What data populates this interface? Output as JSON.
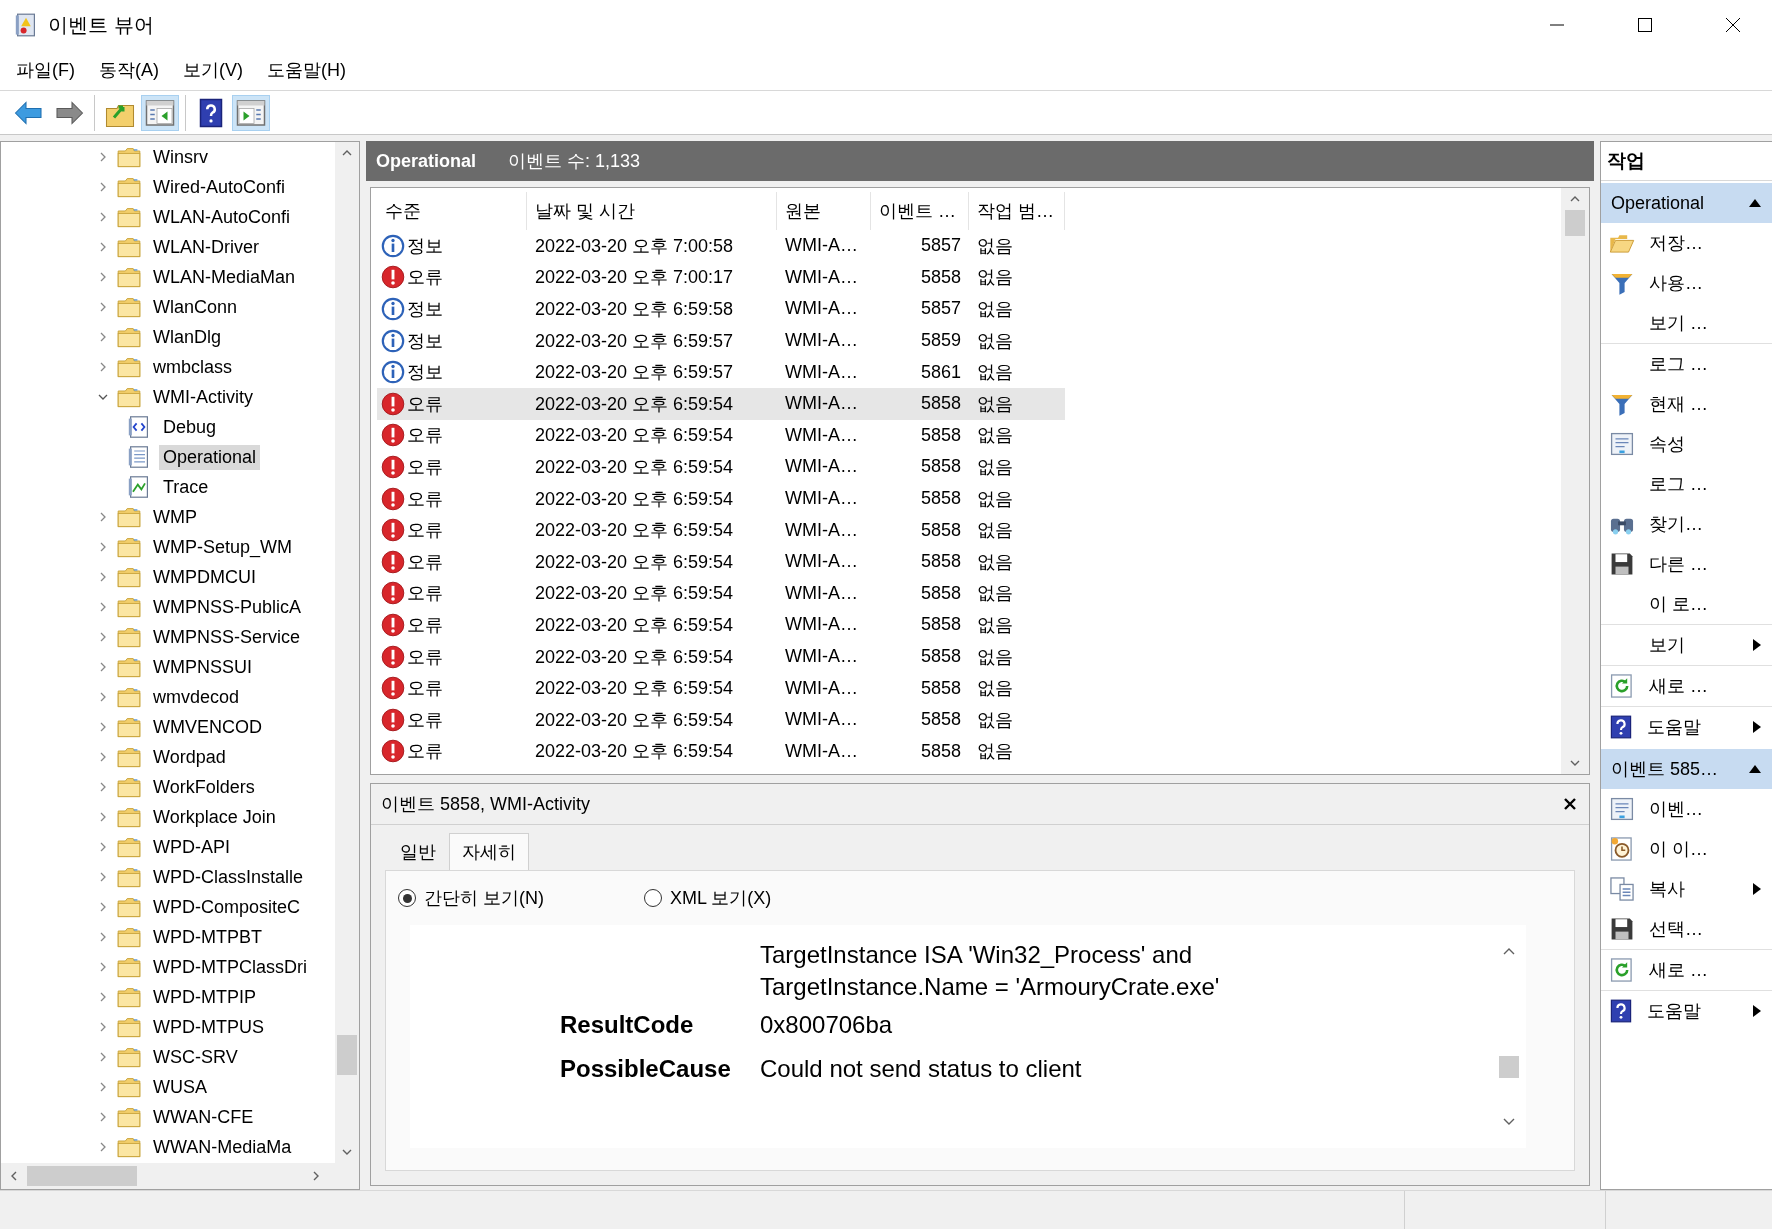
{
  "window": {
    "title": "이벤트 뷰어"
  },
  "menu": [
    "파일(F)",
    "동작(A)",
    "보기(V)",
    "도움말(H)"
  ],
  "toolbar": [
    [
      {
        "kind": "back",
        "pressed": false
      },
      {
        "kind": "forward",
        "pressed": false
      }
    ],
    [
      {
        "kind": "up",
        "pressed": false
      },
      {
        "kind": "tree",
        "pressed": true
      }
    ],
    [
      {
        "kind": "help",
        "pressed": false
      },
      {
        "kind": "actions",
        "pressed": true
      }
    ]
  ],
  "tree": [
    {
      "label": "Winsrv",
      "kind": "folder",
      "expanded": false,
      "selected": false
    },
    {
      "label": "Wired-AutoConfi",
      "kind": "folder",
      "expanded": false,
      "selected": false
    },
    {
      "label": "WLAN-AutoConfi",
      "kind": "folder",
      "expanded": false,
      "selected": false
    },
    {
      "label": "WLAN-Driver",
      "kind": "folder",
      "expanded": false,
      "selected": false
    },
    {
      "label": "WLAN-MediaMan",
      "kind": "folder",
      "expanded": false,
      "selected": false
    },
    {
      "label": "WlanConn",
      "kind": "folder",
      "expanded": false,
      "selected": false
    },
    {
      "label": "WlanDlg",
      "kind": "folder",
      "expanded": false,
      "selected": false
    },
    {
      "label": "wmbclass",
      "kind": "folder",
      "expanded": false,
      "selected": false
    },
    {
      "label": "WMI-Activity",
      "kind": "folder",
      "expanded": true,
      "selected": false,
      "children": [
        {
          "label": "Debug",
          "kind": "debug",
          "selected": false
        },
        {
          "label": "Operational",
          "kind": "log",
          "selected": true
        },
        {
          "label": "Trace",
          "kind": "trace",
          "selected": false
        }
      ]
    },
    {
      "label": "WMP",
      "kind": "folder",
      "expanded": false,
      "selected": false
    },
    {
      "label": "WMP-Setup_WM",
      "kind": "folder",
      "expanded": false,
      "selected": false
    },
    {
      "label": "WMPDMCUI",
      "kind": "folder",
      "expanded": false,
      "selected": false
    },
    {
      "label": "WMPNSS-PublicA",
      "kind": "folder",
      "expanded": false,
      "selected": false
    },
    {
      "label": "WMPNSS-Service",
      "kind": "folder",
      "expanded": false,
      "selected": false
    },
    {
      "label": "WMPNSSUI",
      "kind": "folder",
      "expanded": false,
      "selected": false
    },
    {
      "label": "wmvdecod",
      "kind": "folder",
      "expanded": false,
      "selected": false
    },
    {
      "label": "WMVENCOD",
      "kind": "folder",
      "expanded": false,
      "selected": false
    },
    {
      "label": "Wordpad",
      "kind": "folder",
      "expanded": false,
      "selected": false
    },
    {
      "label": "WorkFolders",
      "kind": "folder",
      "expanded": false,
      "selected": false
    },
    {
      "label": "Workplace Join",
      "kind": "folder",
      "expanded": false,
      "selected": false
    },
    {
      "label": "WPD-API",
      "kind": "folder",
      "expanded": false,
      "selected": false
    },
    {
      "label": "WPD-ClassInstalle",
      "kind": "folder",
      "expanded": false,
      "selected": false
    },
    {
      "label": "WPD-CompositeC",
      "kind": "folder",
      "expanded": false,
      "selected": false
    },
    {
      "label": "WPD-MTPBT",
      "kind": "folder",
      "expanded": false,
      "selected": false
    },
    {
      "label": "WPD-MTPClassDri",
      "kind": "folder",
      "expanded": false,
      "selected": false
    },
    {
      "label": "WPD-MTPIP",
      "kind": "folder",
      "expanded": false,
      "selected": false
    },
    {
      "label": "WPD-MTPUS",
      "kind": "folder",
      "expanded": false,
      "selected": false
    },
    {
      "label": "WSC-SRV",
      "kind": "folder",
      "expanded": false,
      "selected": false
    },
    {
      "label": "WUSA",
      "kind": "folder",
      "expanded": false,
      "selected": false
    },
    {
      "label": "WWAN-CFE",
      "kind": "folder",
      "expanded": false,
      "selected": false
    },
    {
      "label": "WWAN-MediaMa",
      "kind": "folder",
      "expanded": false,
      "selected": false
    }
  ],
  "log_header": {
    "name": "Operational",
    "count": "이벤트 수: 1,133"
  },
  "events": {
    "columns": [
      "수준",
      "날짜 및 시간",
      "원본",
      "이벤트 …",
      "작업 범…"
    ],
    "rows": [
      {
        "kind": "info",
        "level": "정보",
        "date": "2022-03-20 오후 7:00:58",
        "source": "WMI-A…",
        "event_id": "5857",
        "task": "없음",
        "selected": false
      },
      {
        "kind": "error",
        "level": "오류",
        "date": "2022-03-20 오후 7:00:17",
        "source": "WMI-A…",
        "event_id": "5858",
        "task": "없음",
        "selected": false
      },
      {
        "kind": "info",
        "level": "정보",
        "date": "2022-03-20 오후 6:59:58",
        "source": "WMI-A…",
        "event_id": "5857",
        "task": "없음",
        "selected": false
      },
      {
        "kind": "info",
        "level": "정보",
        "date": "2022-03-20 오후 6:59:57",
        "source": "WMI-A…",
        "event_id": "5859",
        "task": "없음",
        "selected": false
      },
      {
        "kind": "info",
        "level": "정보",
        "date": "2022-03-20 오후 6:59:57",
        "source": "WMI-A…",
        "event_id": "5861",
        "task": "없음",
        "selected": false
      },
      {
        "kind": "error",
        "level": "오류",
        "date": "2022-03-20 오후 6:59:54",
        "source": "WMI-A…",
        "event_id": "5858",
        "task": "없음",
        "selected": true
      },
      {
        "kind": "error",
        "level": "오류",
        "date": "2022-03-20 오후 6:59:54",
        "source": "WMI-A…",
        "event_id": "5858",
        "task": "없음",
        "selected": false
      },
      {
        "kind": "error",
        "level": "오류",
        "date": "2022-03-20 오후 6:59:54",
        "source": "WMI-A…",
        "event_id": "5858",
        "task": "없음",
        "selected": false
      },
      {
        "kind": "error",
        "level": "오류",
        "date": "2022-03-20 오후 6:59:54",
        "source": "WMI-A…",
        "event_id": "5858",
        "task": "없음",
        "selected": false
      },
      {
        "kind": "error",
        "level": "오류",
        "date": "2022-03-20 오후 6:59:54",
        "source": "WMI-A…",
        "event_id": "5858",
        "task": "없음",
        "selected": false
      },
      {
        "kind": "error",
        "level": "오류",
        "date": "2022-03-20 오후 6:59:54",
        "source": "WMI-A…",
        "event_id": "5858",
        "task": "없음",
        "selected": false
      },
      {
        "kind": "error",
        "level": "오류",
        "date": "2022-03-20 오후 6:59:54",
        "source": "WMI-A…",
        "event_id": "5858",
        "task": "없음",
        "selected": false
      },
      {
        "kind": "error",
        "level": "오류",
        "date": "2022-03-20 오후 6:59:54",
        "source": "WMI-A…",
        "event_id": "5858",
        "task": "없음",
        "selected": false
      },
      {
        "kind": "error",
        "level": "오류",
        "date": "2022-03-20 오후 6:59:54",
        "source": "WMI-A…",
        "event_id": "5858",
        "task": "없음",
        "selected": false
      },
      {
        "kind": "error",
        "level": "오류",
        "date": "2022-03-20 오후 6:59:54",
        "source": "WMI-A…",
        "event_id": "5858",
        "task": "없음",
        "selected": false
      },
      {
        "kind": "error",
        "level": "오류",
        "date": "2022-03-20 오후 6:59:54",
        "source": "WMI-A…",
        "event_id": "5858",
        "task": "없음",
        "selected": false
      },
      {
        "kind": "error",
        "level": "오류",
        "date": "2022-03-20 오후 6:59:54",
        "source": "WMI-A…",
        "event_id": "5858",
        "task": "없음",
        "selected": false
      }
    ]
  },
  "details": {
    "title": "이벤트 5858, WMI-Activity",
    "tabs": [
      {
        "label": "일반",
        "selected": false
      },
      {
        "label": "자세히",
        "selected": true
      }
    ],
    "views": [
      {
        "label": "간단히 보기(N)",
        "selected": true
      },
      {
        "label": "XML 보기(X)",
        "selected": false
      }
    ],
    "value_lines": [
      "TargetInstance ISA 'Win32_Process' and",
      "TargetInstance.Name = 'ArmouryCrate.exe'"
    ],
    "fields": [
      {
        "name": "ResultCode",
        "value": "0x800706ba"
      },
      {
        "name": "PossibleCause",
        "value": "Could not send status to client"
      }
    ]
  },
  "actions": {
    "title": "작업",
    "sections": [
      {
        "title": "Operational",
        "expanded": true,
        "items": [
          {
            "label": "저장…",
            "kind": "open",
            "submenu": false,
            "separator_after": false
          },
          {
            "label": "사용…",
            "kind": "filter",
            "submenu": false,
            "separator_after": false
          },
          {
            "label": "보기 …",
            "kind": "none",
            "submenu": false,
            "separator_after": true
          },
          {
            "label": "로그 …",
            "kind": "none",
            "submenu": false,
            "separator_after": false
          },
          {
            "label": "현재 …",
            "kind": "filter",
            "submenu": false,
            "separator_after": false
          },
          {
            "label": "속성",
            "kind": "properties",
            "submenu": false,
            "separator_after": false
          },
          {
            "label": "로그 …",
            "kind": "none",
            "submenu": false,
            "separator_after": false
          },
          {
            "label": "찾기…",
            "kind": "binoculars",
            "submenu": false,
            "separator_after": false
          },
          {
            "label": "다른 …",
            "kind": "save",
            "submenu": false,
            "separator_after": false
          },
          {
            "label": "이 로…",
            "kind": "none",
            "submenu": false,
            "separator_after": true
          },
          {
            "label": "보기",
            "kind": "none",
            "submenu": true,
            "separator_after": true
          },
          {
            "label": "새로 …",
            "kind": "refresh",
            "submenu": false,
            "separator_after": true
          },
          {
            "label": "도움말",
            "kind": "help",
            "submenu": true,
            "separator_after": false
          }
        ]
      },
      {
        "title": "이벤트 585…",
        "expanded": true,
        "items": [
          {
            "label": "이벤…",
            "kind": "properties",
            "submenu": false,
            "separator_after": false
          },
          {
            "label": "이 이…",
            "kind": "task",
            "submenu": false,
            "separator_after": false
          },
          {
            "label": "복사",
            "kind": "copy",
            "submenu": true,
            "separator_after": false
          },
          {
            "label": "선택…",
            "kind": "save",
            "submenu": false,
            "separator_after": true
          },
          {
            "label": "새로 …",
            "kind": "refresh",
            "submenu": false,
            "separator_after": true
          },
          {
            "label": "도움말",
            "kind": "help",
            "submenu": true,
            "separator_after": false
          }
        ]
      }
    ]
  }
}
